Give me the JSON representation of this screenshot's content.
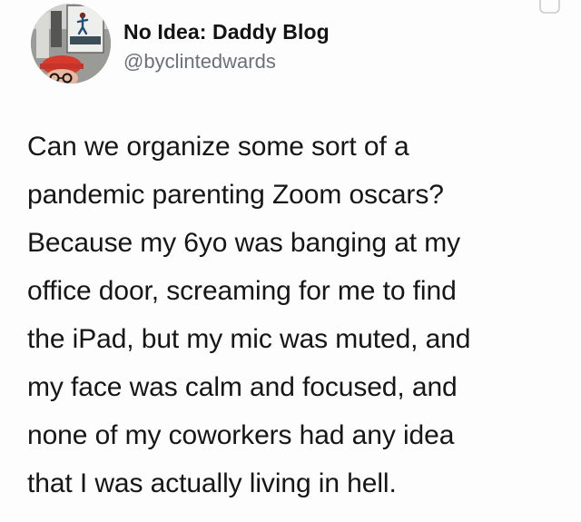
{
  "tweet": {
    "author": {
      "display_name": "No Idea: Daddy Blog",
      "handle": "@byclintedwards",
      "avatar_icon": "profile-photo-man-with-red-cap"
    },
    "corner_icon": "caret-down-icon",
    "body_lines": [
      "Can we organize some sort of a",
      "pandemic parenting Zoom oscars?",
      "Because my 6yo was banging at my",
      "office door, screaming for me to find",
      "the iPad, but my mic was muted, and",
      "my face was calm and focused, and",
      "none of my coworkers had any idea",
      "that I was actually living in hell."
    ]
  },
  "colors": {
    "text": "#161616",
    "secondary_text": "#6c7079",
    "background": "#fdfdfd"
  }
}
